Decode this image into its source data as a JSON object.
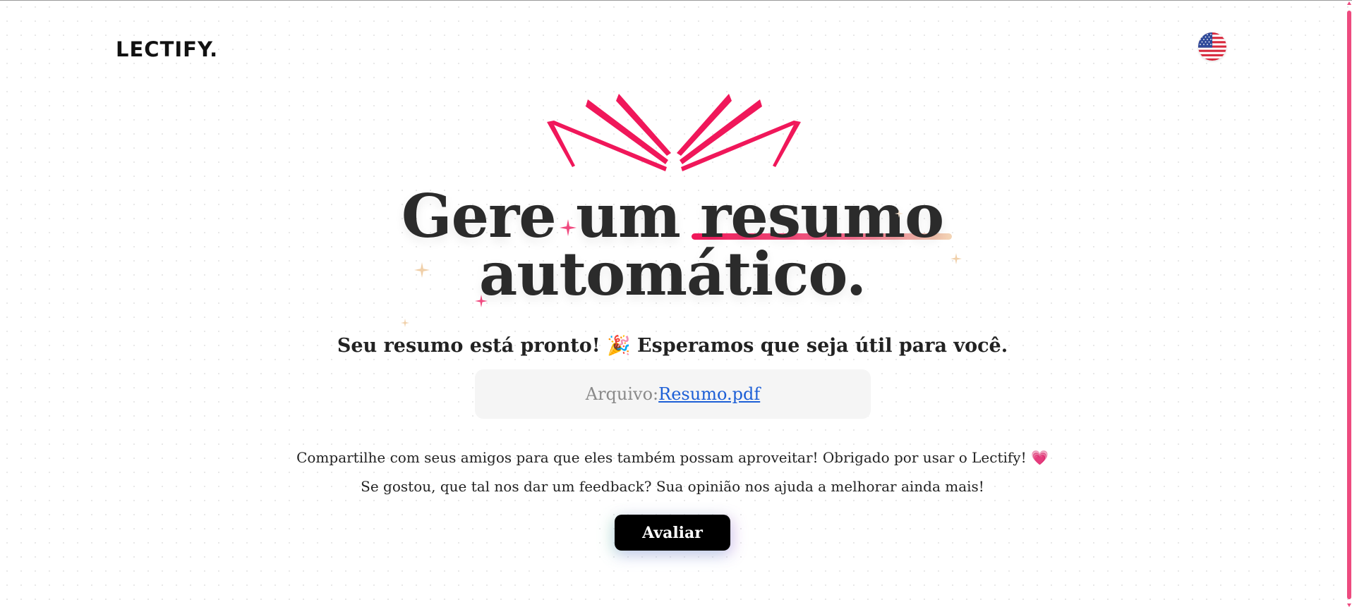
{
  "header": {
    "logo_text": "LECTIFY.",
    "language_icon": "us-flag-icon"
  },
  "hero": {
    "logo_icon": "open-book-icon",
    "title_part1": "Gere um ",
    "title_highlight": "resumo",
    "title_line2": "automático.",
    "accent_color": "#f0175a"
  },
  "result": {
    "ready_message": "Seu resumo está pronto!",
    "ready_emoji": "🎉",
    "ready_message_2": "Esperamos que seja útil para você.",
    "file_label": "Arquivo:",
    "file_name": "Resumo.pdf"
  },
  "footer_text": {
    "share_message": "Compartilhe com seus amigos para que eles também possam aproveitar! Obrigado por usar o Lectify!",
    "share_emoji": "💗",
    "feedback_message": "Se gostou, que tal nos dar um feedback? Sua opinião nos ajuda a melhorar ainda mais!"
  },
  "actions": {
    "rate_label": "Avaliar"
  }
}
